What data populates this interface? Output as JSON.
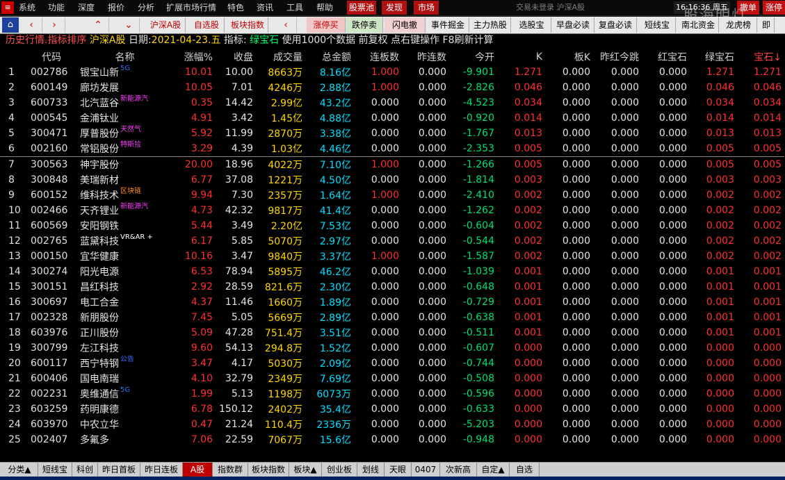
{
  "menu": {
    "logo": "≡",
    "items": [
      "系统",
      "功能",
      "深度",
      "报价",
      "分析",
      "扩展市场行情",
      "特色",
      "资讯",
      "工具",
      "帮助"
    ],
    "tabs": [
      "股票池",
      "发现",
      "市场"
    ],
    "login_status": "交易未登录  沪深A股",
    "time": "16:16:36",
    "weekday": "周五",
    "right_buttons": [
      "撤单",
      "涨停"
    ],
    "watermark": "股海明灯"
  },
  "toolbar": {
    "nav_arrows": [
      "‹",
      "›",
      "⌃",
      "⌄"
    ],
    "buttons_left": [
      "沪深A股",
      "自选股",
      "板块指数"
    ],
    "buttons_right": [
      "涨停买",
      "跌停卖",
      "闪电撤",
      "事件掘金",
      "主力热股",
      "选股宝",
      "早盘必读",
      "复盘必读",
      "短线宝",
      "南北资金",
      "龙虎榜",
      "即"
    ]
  },
  "info": {
    "title": "历史行情.指标排序",
    "market": "沪深A股",
    "date_label": "日期:",
    "date": "2021-04-23.五",
    "indicator_label": "指标:",
    "indicator": "绿宝石",
    "note": "使用1000个数据 前复权 点右键操作 F8刷新计算"
  },
  "columns": [
    "代码",
    "名称",
    "涨幅%",
    "收盘",
    "成交量",
    "总金额",
    "连板数",
    "昨连数",
    "今开",
    "K",
    "板K",
    "昨红今跳",
    "红宝石",
    "绿宝石",
    "宝石↓"
  ],
  "rows": [
    {
      "idx": "1",
      "code": "002786",
      "name": "银宝山新",
      "tag": "5G",
      "chg": "10.01",
      "close": "10.00",
      "vol": "8663万",
      "amt": "8.16亿",
      "lb": "1.000",
      "zl": "0.000",
      "open": "-9.901",
      "k": "1.271",
      "bk": "0.000",
      "zhjt": "0.000",
      "hbs": "0.000",
      "lbs": "1.271",
      "bs": "1.271"
    },
    {
      "idx": "2",
      "code": "600149",
      "name": "廊坊发展",
      "tag": "",
      "chg": "10.05",
      "close": "7.01",
      "vol": "4246万",
      "amt": "2.88亿",
      "lb": "1.000",
      "zl": "0.000",
      "open": "-2.826",
      "k": "0.046",
      "bk": "0.000",
      "zhjt": "0.000",
      "hbs": "0.000",
      "lbs": "0.046",
      "bs": "0.046"
    },
    {
      "idx": "3",
      "code": "600733",
      "name": "北汽蓝谷",
      "tag": "新能源汽",
      "chg": "0.35",
      "close": "14.42",
      "vol": "2.99亿",
      "amt": "43.2亿",
      "lb": "0.000",
      "zl": "0.000",
      "open": "-4.523",
      "k": "0.034",
      "bk": "0.000",
      "zhjt": "0.000",
      "hbs": "0.000",
      "lbs": "0.034",
      "bs": "0.034"
    },
    {
      "idx": "4",
      "code": "000545",
      "name": "金浦钛业",
      "tag": "",
      "chg": "4.91",
      "close": "3.42",
      "vol": "1.45亿",
      "amt": "4.88亿",
      "lb": "0.000",
      "zl": "0.000",
      "open": "-0.920",
      "k": "0.014",
      "bk": "0.000",
      "zhjt": "0.000",
      "hbs": "0.000",
      "lbs": "0.014",
      "bs": "0.014"
    },
    {
      "idx": "5",
      "code": "300471",
      "name": "厚普股份",
      "tag": "天然气",
      "chg": "5.92",
      "close": "11.99",
      "vol": "2870万",
      "amt": "3.38亿",
      "lb": "0.000",
      "zl": "0.000",
      "open": "-1.767",
      "k": "0.013",
      "bk": "0.000",
      "zhjt": "0.000",
      "hbs": "0.000",
      "lbs": "0.013",
      "bs": "0.013"
    },
    {
      "idx": "6",
      "code": "002160",
      "name": "常铝股份",
      "tag": "特斯拉",
      "chg": "3.29",
      "close": "4.39",
      "vol": "1.03亿",
      "amt": "4.46亿",
      "lb": "0.000",
      "zl": "0.000",
      "open": "-2.353",
      "k": "0.005",
      "bk": "0.000",
      "zhjt": "0.000",
      "hbs": "0.000",
      "lbs": "0.005",
      "bs": "0.005"
    },
    {
      "idx": "7",
      "code": "300563",
      "name": "神宇股份",
      "tag": "",
      "chg": "20.00",
      "close": "18.96",
      "vol": "4022万",
      "amt": "7.10亿",
      "lb": "1.000",
      "zl": "0.000",
      "open": "-1.266",
      "k": "0.005",
      "bk": "0.000",
      "zhjt": "0.000",
      "hbs": "0.000",
      "lbs": "0.005",
      "bs": "0.005"
    },
    {
      "idx": "8",
      "code": "300848",
      "name": "美瑞新材",
      "tag": "",
      "chg": "6.77",
      "close": "37.08",
      "vol": "1221万",
      "amt": "4.50亿",
      "lb": "0.000",
      "zl": "0.000",
      "open": "-1.814",
      "k": "0.003",
      "bk": "0.000",
      "zhjt": "0.000",
      "hbs": "0.000",
      "lbs": "0.003",
      "bs": "0.003"
    },
    {
      "idx": "9",
      "code": "600152",
      "name": "维科技术",
      "tag": "区块链",
      "chg": "9.94",
      "close": "7.30",
      "vol": "2357万",
      "amt": "1.64亿",
      "lb": "1.000",
      "zl": "0.000",
      "open": "-2.410",
      "k": "0.002",
      "bk": "0.000",
      "zhjt": "0.000",
      "hbs": "0.000",
      "lbs": "0.002",
      "bs": "0.002"
    },
    {
      "idx": "10",
      "code": "002466",
      "name": "天齐锂业",
      "tag": "新能源汽",
      "chg": "4.73",
      "close": "42.32",
      "vol": "9817万",
      "amt": "41.4亿",
      "lb": "0.000",
      "zl": "0.000",
      "open": "-1.262",
      "k": "0.002",
      "bk": "0.000",
      "zhjt": "0.000",
      "hbs": "0.000",
      "lbs": "0.002",
      "bs": "0.002"
    },
    {
      "idx": "11",
      "code": "600569",
      "name": "安阳钢铁",
      "tag": "",
      "chg": "5.44",
      "close": "3.49",
      "vol": "2.20亿",
      "amt": "7.53亿",
      "lb": "0.000",
      "zl": "0.000",
      "open": "-0.604",
      "k": "0.002",
      "bk": "0.000",
      "zhjt": "0.000",
      "hbs": "0.000",
      "lbs": "0.002",
      "bs": "0.002"
    },
    {
      "idx": "12",
      "code": "002765",
      "name": "蓝黛科技",
      "tag": "VR&AR +",
      "chg": "6.17",
      "close": "5.85",
      "vol": "5070万",
      "amt": "2.97亿",
      "lb": "0.000",
      "zl": "0.000",
      "open": "-0.544",
      "k": "0.002",
      "bk": "0.000",
      "zhjt": "0.000",
      "hbs": "0.000",
      "lbs": "0.002",
      "bs": "0.002"
    },
    {
      "idx": "13",
      "code": "000150",
      "name": "宜华健康",
      "tag": "",
      "chg": "10.16",
      "close": "3.47",
      "vol": "9840万",
      "amt": "3.37亿",
      "lb": "1.000",
      "zl": "0.000",
      "open": "-1.587",
      "k": "0.002",
      "bk": "0.000",
      "zhjt": "0.000",
      "hbs": "0.000",
      "lbs": "0.002",
      "bs": "0.002"
    },
    {
      "idx": "14",
      "code": "300274",
      "name": "阳光电源",
      "tag": "",
      "chg": "6.53",
      "close": "78.94",
      "vol": "5895万",
      "amt": "46.2亿",
      "lb": "0.000",
      "zl": "0.000",
      "open": "-1.039",
      "k": "0.001",
      "bk": "0.000",
      "zhjt": "0.000",
      "hbs": "0.000",
      "lbs": "0.001",
      "bs": "0.001"
    },
    {
      "idx": "15",
      "code": "300151",
      "name": "昌红科技",
      "tag": "",
      "chg": "2.92",
      "close": "28.59",
      "vol": "821.6万",
      "amt": "2.30亿",
      "lb": "0.000",
      "zl": "0.000",
      "open": "-0.648",
      "k": "0.001",
      "bk": "0.000",
      "zhjt": "0.000",
      "hbs": "0.000",
      "lbs": "0.001",
      "bs": "0.001"
    },
    {
      "idx": "16",
      "code": "300697",
      "name": "电工合金",
      "tag": "",
      "chg": "4.37",
      "close": "11.46",
      "vol": "1660万",
      "amt": "1.89亿",
      "lb": "0.000",
      "zl": "0.000",
      "open": "-0.729",
      "k": "0.001",
      "bk": "0.000",
      "zhjt": "0.000",
      "hbs": "0.000",
      "lbs": "0.001",
      "bs": "0.001"
    },
    {
      "idx": "17",
      "code": "002328",
      "name": "新朋股份",
      "tag": "",
      "chg": "7.45",
      "close": "5.05",
      "vol": "5669万",
      "amt": "2.89亿",
      "lb": "0.000",
      "zl": "0.000",
      "open": "-0.638",
      "k": "0.001",
      "bk": "0.000",
      "zhjt": "0.000",
      "hbs": "0.000",
      "lbs": "0.001",
      "bs": "0.001"
    },
    {
      "idx": "18",
      "code": "603976",
      "name": "正川股份",
      "tag": "",
      "chg": "5.09",
      "close": "47.28",
      "vol": "751.4万",
      "amt": "3.51亿",
      "lb": "0.000",
      "zl": "0.000",
      "open": "-0.511",
      "k": "0.001",
      "bk": "0.000",
      "zhjt": "0.000",
      "hbs": "0.000",
      "lbs": "0.001",
      "bs": "0.001"
    },
    {
      "idx": "19",
      "code": "300799",
      "name": "左江科技",
      "tag": "",
      "chg": "9.60",
      "close": "54.13",
      "vol": "294.8万",
      "amt": "1.52亿",
      "lb": "0.000",
      "zl": "0.000",
      "open": "-0.607",
      "k": "0.000",
      "bk": "0.000",
      "zhjt": "0.000",
      "hbs": "0.000",
      "lbs": "0.000",
      "bs": "0.000"
    },
    {
      "idx": "20",
      "code": "600117",
      "name": "西宁特钢",
      "tag": "公告",
      "chg": "3.47",
      "close": "4.17",
      "vol": "5030万",
      "amt": "2.09亿",
      "lb": "0.000",
      "zl": "0.000",
      "open": "-0.744",
      "k": "0.000",
      "bk": "0.000",
      "zhjt": "0.000",
      "hbs": "0.000",
      "lbs": "0.000",
      "bs": "0.000"
    },
    {
      "idx": "21",
      "code": "600406",
      "name": "国电南瑞",
      "tag": "",
      "chg": "4.10",
      "close": "32.79",
      "vol": "2349万",
      "amt": "7.69亿",
      "lb": "0.000",
      "zl": "0.000",
      "open": "-0.508",
      "k": "0.000",
      "bk": "0.000",
      "zhjt": "0.000",
      "hbs": "0.000",
      "lbs": "0.000",
      "bs": "0.000"
    },
    {
      "idx": "22",
      "code": "002231",
      "name": "奥维通信",
      "tag": "5G",
      "chg": "1.99",
      "close": "5.13",
      "vol": "1198万",
      "amt": "6073万",
      "lb": "0.000",
      "zl": "0.000",
      "open": "-0.596",
      "k": "0.000",
      "bk": "0.000",
      "zhjt": "0.000",
      "hbs": "0.000",
      "lbs": "0.000",
      "bs": "0.000"
    },
    {
      "idx": "23",
      "code": "603259",
      "name": "药明康德",
      "tag": "",
      "chg": "6.78",
      "close": "150.12",
      "vol": "2402万",
      "amt": "35.4亿",
      "lb": "0.000",
      "zl": "0.000",
      "open": "-0.633",
      "k": "0.000",
      "bk": "0.000",
      "zhjt": "0.000",
      "hbs": "0.000",
      "lbs": "0.000",
      "bs": "0.000"
    },
    {
      "idx": "24",
      "code": "603970",
      "name": "中农立华",
      "tag": "",
      "chg": "0.47",
      "close": "21.24",
      "vol": "110.4万",
      "amt": "2336万",
      "lb": "0.000",
      "zl": "0.000",
      "open": "-5.203",
      "k": "0.000",
      "bk": "0.000",
      "zhjt": "0.000",
      "hbs": "0.000",
      "lbs": "0.000",
      "bs": "0.000"
    },
    {
      "idx": "25",
      "code": "002407",
      "name": "多氟多",
      "tag": "",
      "chg": "7.06",
      "close": "22.59",
      "vol": "7067万",
      "amt": "15.6亿",
      "lb": "0.000",
      "zl": "0.000",
      "open": "-0.948",
      "k": "0.000",
      "bk": "0.000",
      "zhjt": "0.000",
      "hbs": "0.000",
      "lbs": "0.000",
      "bs": "0.000"
    }
  ],
  "bottom_tabs": [
    "分类▲",
    "短线宝",
    "科创",
    "昨日首板",
    "昨日连板",
    "A股",
    "指数群",
    "板块指数",
    "板块▲",
    "创业板",
    "划线",
    "天眼",
    "0407",
    "次新高",
    "自定▲",
    "自选"
  ],
  "active_bottom_tab": "A股",
  "colors": {
    "up": "#ff3030",
    "down": "#00e070",
    "volume": "#ffd700",
    "amount": "#00e0ff",
    "background": "#000000"
  }
}
